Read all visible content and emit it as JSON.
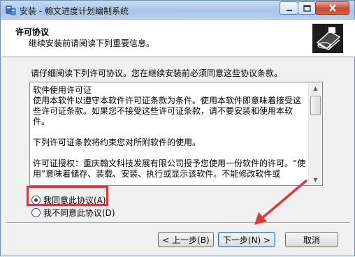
{
  "window": {
    "title": "安装 - 翰文进度计划编制系统"
  },
  "header": {
    "title": "许可协议",
    "subtitle": "继续安装前请阅读下列重要信息。"
  },
  "intro_text": "请仔细阅读下列许可协议。您在继续安装前必须同意这些协议条款。",
  "license": {
    "lines": [
      "软件使用许可证",
      "使用本软件以遵守本软件许可证条款为条件。使用本软件即意味着接受这些许可证条款。如果您不接受这些许可证条款，请不要安装和使用本软件。",
      "下列许可证条款将约束您对所附软件的使用。",
      "许可证授权：重庆翰文科技发展有限公司授予您使用一份软件的许可。“使用”意味着储存、装载、安装、执行或显示该软件。不能修改软件或"
    ]
  },
  "options": {
    "accept_label": "我同意此协议(A)",
    "decline_label": "我不同意此协议(D)",
    "selected": "accept"
  },
  "buttons": {
    "back_label": "< 上一步(B)",
    "next_label": "下一步(N) >",
    "cancel_label": "取消"
  },
  "colors": {
    "annotation": "#e3343a"
  }
}
